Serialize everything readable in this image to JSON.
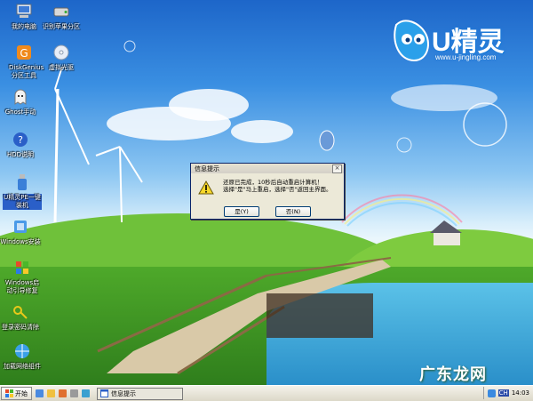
{
  "desktop": {
    "icons": [
      {
        "label": "我的电脑"
      },
      {
        "label": "识别苹果分区"
      },
      {
        "label": "DiskGenius分区工具"
      },
      {
        "label": "虚拟光驱"
      },
      {
        "label": "Ghost手动"
      },
      {
        "label": "HDD说明"
      },
      {
        "label": "U精灵PE一键装机"
      },
      {
        "label": "Windows安装"
      },
      {
        "label": "Windows启动引导修复"
      },
      {
        "label": "登录密码清除"
      },
      {
        "label": "加载网络组件"
      }
    ]
  },
  "logo": {
    "name": "U精灵",
    "url": "www.u-jingling.com"
  },
  "dialog": {
    "title": "信息提示",
    "close": "×",
    "message_line1": "还原已完成，10秒后自动重启计算机！",
    "message_line2": "选择\"是\"马上重启，选择\"否\"返回主界面。",
    "yes_label": "是(Y)",
    "no_label": "否(N)"
  },
  "taskbar": {
    "start_label": "开始",
    "task_label": "信息提示",
    "tray_lang": "CH",
    "clock": "14:03"
  },
  "watermark": "广东龙网",
  "colors": {
    "accent": "#0a246a",
    "sky": "#3a8fe2"
  }
}
